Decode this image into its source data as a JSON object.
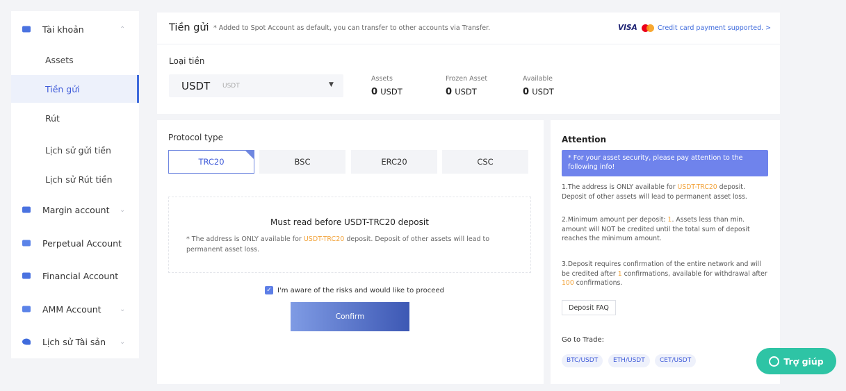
{
  "sidebar": {
    "account": {
      "label": "Tài khoản",
      "icon": "wallet-icon"
    },
    "sub_items": [
      {
        "label": "Assets"
      },
      {
        "label": "Tiền gửi"
      },
      {
        "label": "Rút"
      },
      {
        "label": "Lịch sử gửi tiền"
      },
      {
        "label": "Lịch sử Rút tiền"
      }
    ],
    "sections": [
      {
        "label": "Margin account",
        "icon": "margin-icon"
      },
      {
        "label": "Perpetual Account",
        "icon": "perpetual-icon"
      },
      {
        "label": "Financial Account",
        "icon": "financial-icon"
      },
      {
        "label": "AMM Account",
        "icon": "amm-icon"
      },
      {
        "label": "Lịch sử Tài sản",
        "icon": "history-icon"
      }
    ]
  },
  "header": {
    "title": "Tiền gửi",
    "note": "* Added to Spot Account as default, you can transfer to other accounts via Transfer.",
    "visa_logo": "VISA",
    "credit_link": "Credit card payment supported. >"
  },
  "coin": {
    "label": "Loại tiền",
    "selected": "USDT",
    "selected_sub": "USDT"
  },
  "balances": [
    {
      "label": "Assets",
      "value": "0",
      "unit": "USDT"
    },
    {
      "label": "Frozen Asset",
      "value": "0",
      "unit": "USDT"
    },
    {
      "label": "Available",
      "value": "0",
      "unit": "USDT"
    }
  ],
  "protocol": {
    "label": "Protocol type",
    "tabs": [
      "TRC20",
      "BSC",
      "ERC20",
      "CSC"
    ],
    "active": "TRC20"
  },
  "notice": {
    "title": "Must read before USDT-TRC20 deposit",
    "text_pre": "* The address is ONLY available for ",
    "highlight": "USDT-TRC20",
    "text_post": " deposit. Deposit of other assets will lead to permanent asset loss."
  },
  "agree": {
    "label": "I'm aware of the risks and would like to proceed",
    "checked": true
  },
  "confirm_label": "Confirm",
  "attention": {
    "title": "Attention",
    "box": "* For your asset security, please pay attention to the following info!",
    "item1_pre": "1.The address is ONLY available for ",
    "item1_hl": "USDT-TRC20",
    "item1_post": " deposit. Deposit of other assets will lead to permanent asset loss.",
    "item2_pre": "2.Minimum amount per deposit: ",
    "item2_hl": "1",
    "item2_post": ". Assets less than min. amount will NOT be credited until the total sum of deposit reaches the minimum amount.",
    "item3_pre": "3.Deposit requires confirmation of the entire network and will be credited after ",
    "item3_hl1": "1",
    "item3_mid": " confirmations, available for withdrawal after ",
    "item3_hl2": "100",
    "item3_post": " confirmations.",
    "faq": "Deposit FAQ",
    "goto": "Go to Trade:",
    "pairs": [
      "BTC/USDT",
      "ETH/USDT",
      "CET/USDT"
    ]
  },
  "help_label": "Trợ giúp",
  "colors": {
    "accent": "#3f6bdc",
    "highlight": "#f2a33a",
    "help": "#2ec4a5",
    "attention_box": "#6f83ec"
  }
}
